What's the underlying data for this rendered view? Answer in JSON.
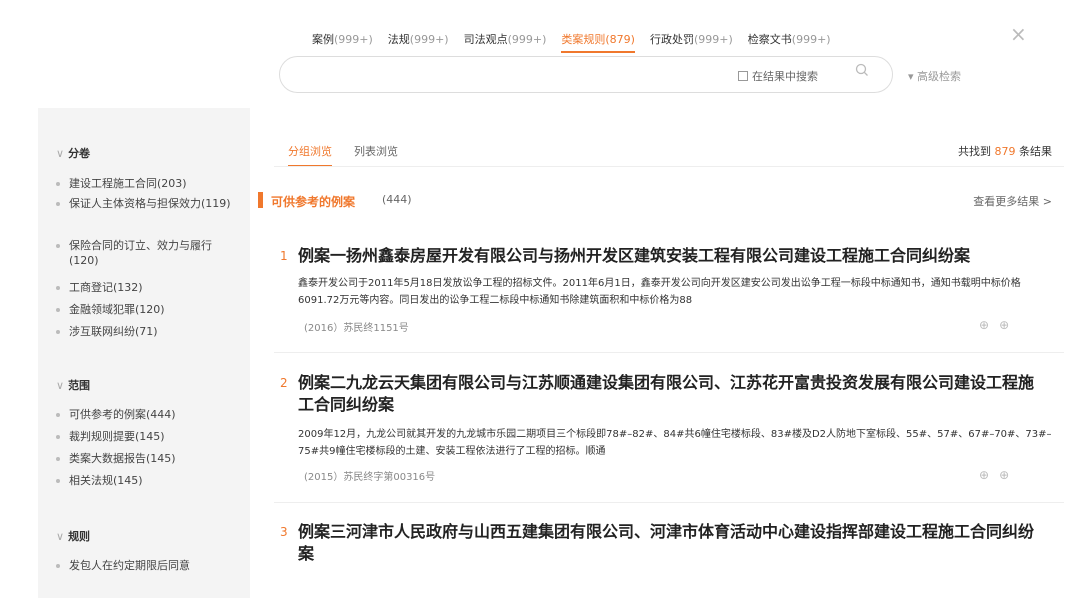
{
  "header": {
    "tabs": [
      {
        "label": "案例",
        "count": "(999+)"
      },
      {
        "label": "法规",
        "count": "(999+)"
      },
      {
        "label": "司法观点",
        "count": "(999+)"
      },
      {
        "label": "类案规则",
        "count": "(879)"
      },
      {
        "label": "行政处罚",
        "count": "(999+)"
      },
      {
        "label": "检察文书",
        "count": "(999+)"
      }
    ],
    "active_tab": 3,
    "close_label": "×"
  },
  "search": {
    "value": "",
    "in_results_label": "在结果中搜索",
    "advanced_label": "▾ 高级检索"
  },
  "sidebar": {
    "sections": [
      {
        "title": "分卷",
        "items": [
          "建设工程施工合同(203)",
          "保证人主体资格与担保效力(119)",
          "保险合同的订立、效力与履行(120)",
          "工商登记(132)",
          "金融领域犯罪(120)",
          "涉互联网纠纷(71)"
        ]
      },
      {
        "title": "范围",
        "items": [
          "可供参考的例案(444)",
          "裁判规则提要(145)",
          "类案大数据报告(145)",
          "相关法规(145)"
        ]
      },
      {
        "title": "规则",
        "items": [
          "发包人在约定期限后同意"
        ]
      }
    ]
  },
  "main": {
    "subtabs": [
      "分组浏览",
      "列表浏览"
    ],
    "total_prefix": "共找到",
    "total_count": "879",
    "total_suffix": "条结果",
    "group": {
      "name": "可供参考的例案",
      "count": "(444)",
      "more": "查看更多结果 >"
    },
    "cases": [
      {
        "index": "1",
        "title": "例案一扬州鑫泰房屋开发有限公司与扬州开发区建筑安装工程有限公司建设工程施工合同纠纷案",
        "summary": "鑫泰开发公司于2011年5月18日发放讼争工程的招标文件。2011年6月1日，鑫泰开发公司向开发区建安公司发出讼争工程一标段中标通知书，通知书载明中标价格6091.72万元等内容。同日发出的讼争工程二标段中标通知书除建筑面积和中标价格为88",
        "ref": "(2016）苏民终1151号"
      },
      {
        "index": "2",
        "title": "例案二九龙云天集团有限公司与江苏顺通建设集团有限公司、江苏花开富贵投资发展有限公司建设工程施工合同纠纷案",
        "summary": "2009年12月，九龙公司就其开发的九龙城市乐园二期项目三个标段即78#–82#、84#共6幢住宅楼标段、83#楼及D2人防地下室标段、55#、57#、67#–70#、73#–75#共9幢住宅楼标段的土建、安装工程依法进行了工程的招标。顺通",
        "ref": "(2015）苏民终字第00316号"
      },
      {
        "index": "3",
        "title": "例案三河津市人民政府与山西五建集团有限公司、河津市体育活动中心建设指挥部建设工程施工合同纠纷案",
        "summary": "",
        "ref": ""
      }
    ]
  }
}
